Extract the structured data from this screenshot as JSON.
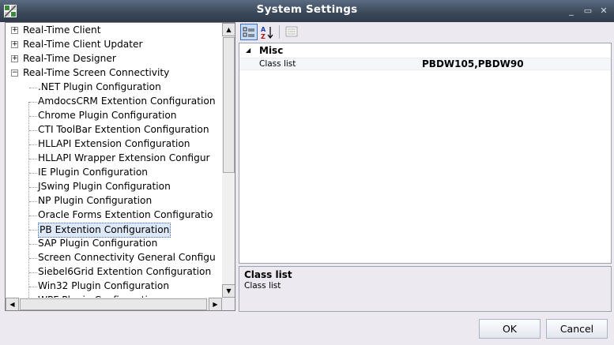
{
  "window": {
    "title": "System Settings",
    "app_icon": "settings-grid-icon",
    "minimize_glyph": "_",
    "maximize_glyph": "▭",
    "close_glyph": "✕"
  },
  "tree": {
    "nodes": [
      {
        "label": "Real-Time Client",
        "expander": "+"
      },
      {
        "label": "Real-Time Client Updater",
        "expander": "+"
      },
      {
        "label": "Real-Time Designer",
        "expander": "+"
      },
      {
        "label": "Real-Time Screen Connectivity",
        "expander": "−"
      },
      {
        "label": ".NET Plugin Configuration"
      },
      {
        "label": "AmdocsCRM Extention Configuration"
      },
      {
        "label": "Chrome Plugin Configuration"
      },
      {
        "label": "CTI ToolBar Extention Configuration"
      },
      {
        "label": "HLLAPI Extension Configuration"
      },
      {
        "label": "HLLAPI Wrapper Extension Configur"
      },
      {
        "label": "IE Plugin Configuration"
      },
      {
        "label": "JSwing Plugin Configuration"
      },
      {
        "label": "NP Plugin Configuration"
      },
      {
        "label": "Oracle Forms Extention Configuratio"
      },
      {
        "label": "PB Extention Configuration",
        "selected": true
      },
      {
        "label": "SAP Plugin Configuration"
      },
      {
        "label": "Screen Connectivity General Configu"
      },
      {
        "label": "Siebel6Grid Extention Configuration"
      },
      {
        "label": "Win32 Plugin Configuration"
      },
      {
        "label": "WPF Plugin Configuration"
      }
    ],
    "scroll_up_glyph": "▲",
    "scroll_down_glyph": "▼",
    "scroll_left_glyph": "◀",
    "scroll_right_glyph": "▶"
  },
  "toolbar": {
    "categorized_icon": "categorized-icon",
    "alphabetical_icon": "sort-az-icon",
    "property_pages_icon": "property-pages-icon",
    "alphabetical_glyph": "A↓Z"
  },
  "properties": {
    "category": "Misc",
    "category_toggle": "◢",
    "rows": [
      {
        "name": "Class list",
        "value": "PBDW105,PBDW90"
      }
    ]
  },
  "description": {
    "title": "Class list",
    "text": "Class list"
  },
  "footer": {
    "ok_label": "OK",
    "cancel_label": "Cancel"
  }
}
